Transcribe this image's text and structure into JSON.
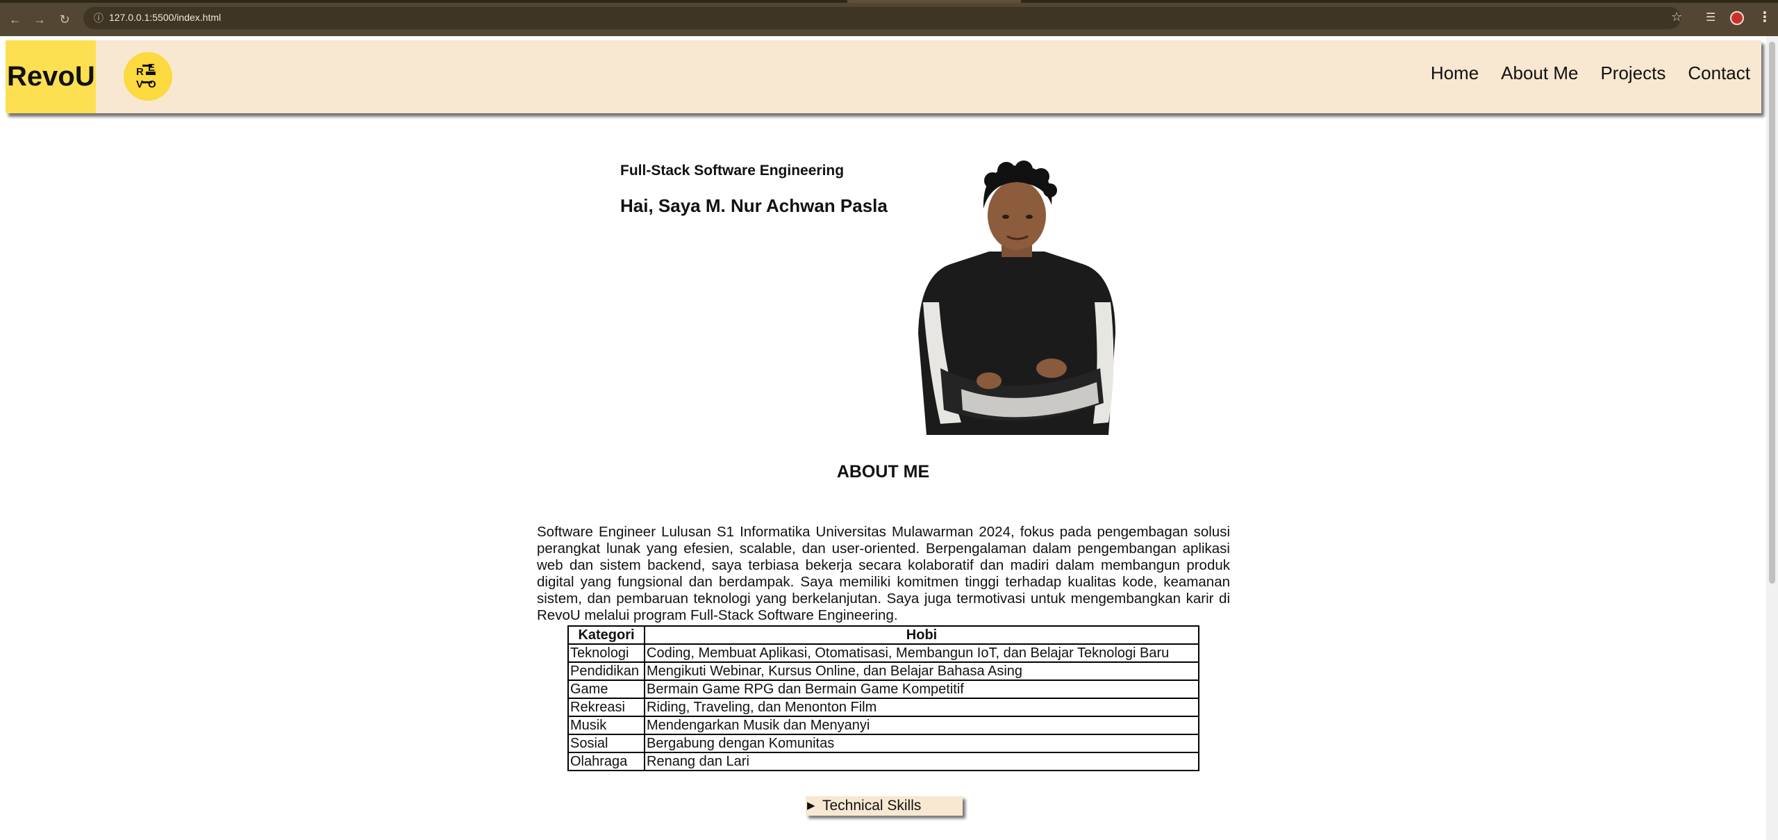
{
  "browser": {
    "url": "127.0.0.1:5500/index.html",
    "colors": {
      "frame": "#534632",
      "urlbar": "#3f3525"
    }
  },
  "navbar": {
    "brand": "RevoU",
    "logo_letters": [
      "R",
      "E",
      "V",
      "O"
    ],
    "links": [
      "Home",
      "About Me",
      "Projects",
      "Contact"
    ],
    "colors": {
      "background": "#f8e8d1",
      "brand_box": "#fde052"
    }
  },
  "hero": {
    "subtitle": "Full-Stack Software Engineering",
    "title": "Hai, Saya M. Nur Achwan Pasla"
  },
  "about": {
    "heading": "ABOUT ME",
    "text": "Software Engineer Lulusan S1 Informatika Universitas Mulawarman 2024, fokus pada pengembagan solusi perangkat lunak yang efesien, scalable, dan user-oriented. Berpengalaman dalam pengembangan aplikasi web dan sistem backend, saya terbiasa bekerja secara kolaboratif dan madiri dalam membangun produk digital yang fungsional dan berdampak. Saya memiliki komitmen tinggi terhadap kualitas kode, keamanan sistem, dan pembaruan teknologi yang berkelanjutan. Saya juga termotivasi untuk mengembangkan karir di RevoU melalui program Full-Stack Software Engineering."
  },
  "hobby_table": {
    "headers": [
      "Kategori",
      "Hobi"
    ],
    "rows": [
      [
        "Teknologi",
        "Coding, Membuat Aplikasi, Otomatisasi, Membangun IoT, dan Belajar Teknologi Baru"
      ],
      [
        "Pendidikan",
        "Mengikuti Webinar, Kursus Online, dan Belajar Bahasa Asing"
      ],
      [
        "Game",
        "Bermain Game RPG dan Bermain Game Kompetitif"
      ],
      [
        "Rekreasi",
        "Riding, Traveling, dan Menonton Film"
      ],
      [
        "Musik",
        "Mendengarkan Musik dan Menyanyi"
      ],
      [
        "Sosial",
        "Bergabung dengan Komunitas"
      ],
      [
        "Olahraga",
        "Renang dan Lari"
      ]
    ]
  },
  "skills_toggle": {
    "arrow": "▶",
    "label": "Technical Skills"
  }
}
